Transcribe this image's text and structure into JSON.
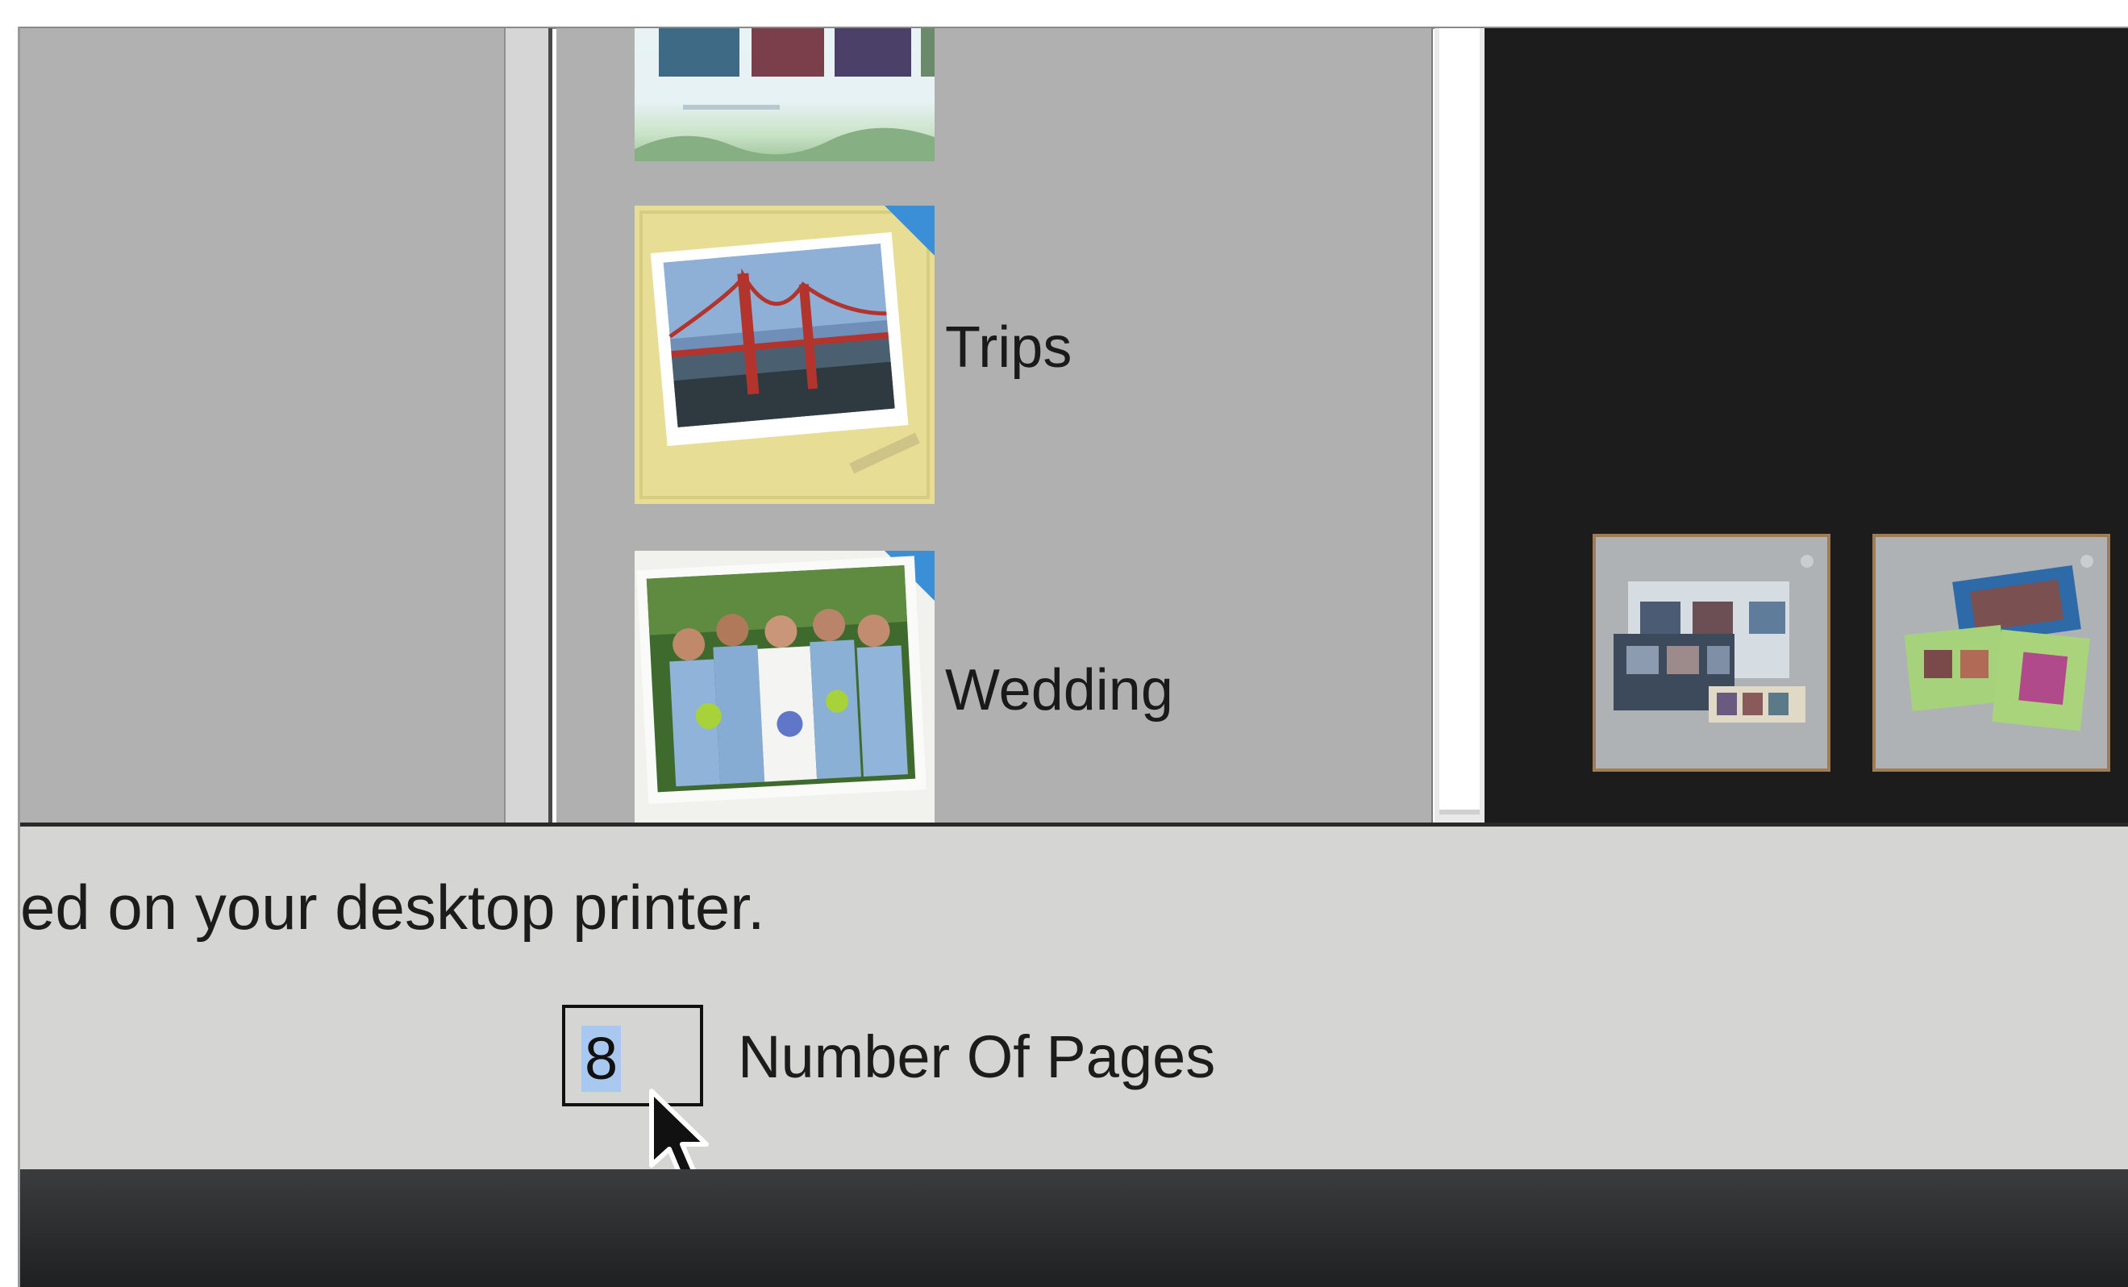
{
  "themes": [
    {
      "label": "Trips"
    },
    {
      "label": "Wedding"
    }
  ],
  "description_fragment": "ed on your desktop printer.",
  "pages_field": {
    "value": "8",
    "label": "Number Of Pages"
  },
  "icons": {
    "cursor": "arrow-cursor-icon"
  }
}
